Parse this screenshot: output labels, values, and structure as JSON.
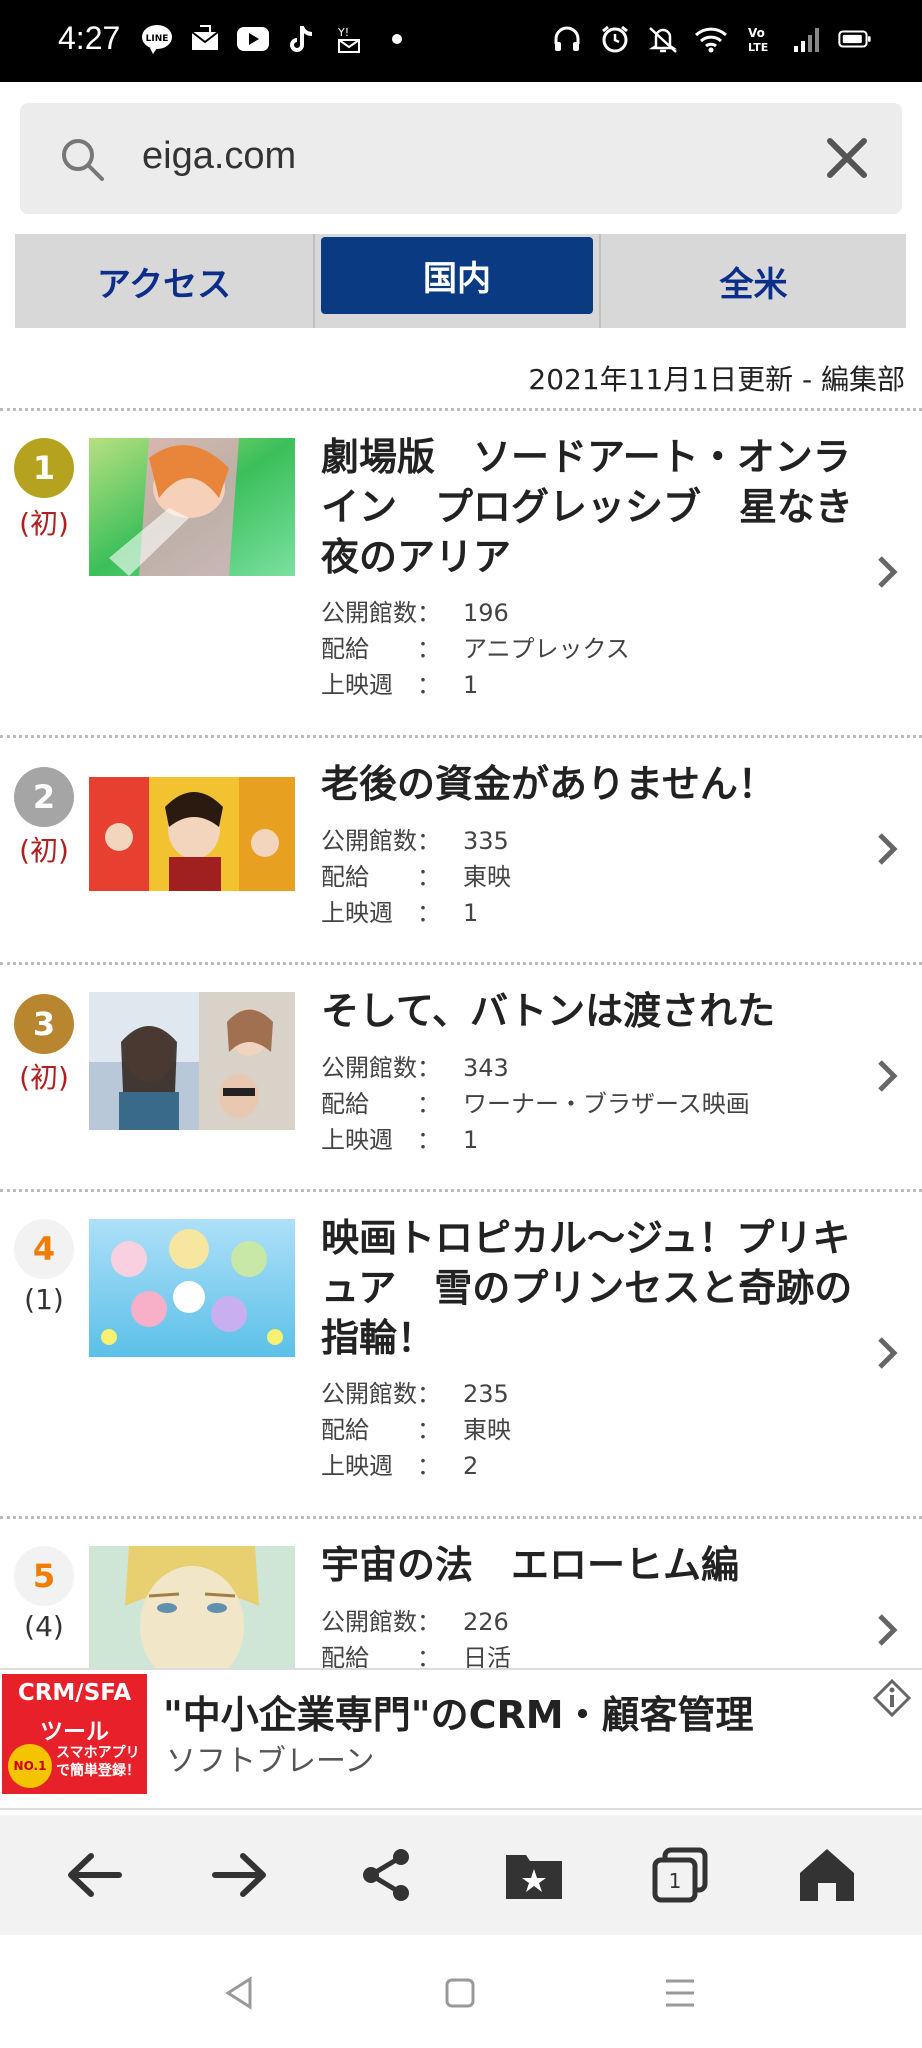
{
  "status_bar": {
    "time": "4:27",
    "left_icons": [
      "line-icon",
      "mail-icon",
      "youtube-icon",
      "tiktok-icon",
      "yahoo-mail-icon",
      "dot-icon"
    ],
    "right_icons": [
      "headphones-icon",
      "alarm-icon",
      "vibrate-off-icon",
      "wifi-icon",
      "volte-icon",
      "signal-icon",
      "battery-icon"
    ],
    "volte_label": "Vo LTE"
  },
  "url_bar": {
    "url": "eiga.com"
  },
  "tabs": [
    {
      "label": "アクセス",
      "active": false
    },
    {
      "label": "国内",
      "active": true
    },
    {
      "label": "全米",
      "active": false
    }
  ],
  "updated_text": "2021年11月1日更新 - 編集部",
  "meta_labels": {
    "theaters": "公開館数：",
    "distributor": "配給　　：",
    "weeks": "上映週　："
  },
  "rankings": [
    {
      "rank": "1",
      "previous": "(初)",
      "badge_color": "#b5a31f",
      "title": "劇場版　ソードアート・オンライン　プログレッシブ　星なき夜のアリア",
      "theaters": "196",
      "distributor": "アニプレックス",
      "weeks": "1"
    },
    {
      "rank": "2",
      "previous": "(初)",
      "badge_color": "#a5a5a5",
      "title": "老後の資金がありません！",
      "theaters": "335",
      "distributor": "東映",
      "weeks": "1"
    },
    {
      "rank": "3",
      "previous": "(初)",
      "badge_color": "#b8862f",
      "title": "そして、バトンは渡された",
      "theaters": "343",
      "distributor": "ワーナー・ブラザース映画",
      "weeks": "1"
    },
    {
      "rank": "4",
      "previous": "(1)",
      "badge_color": "#f07d00",
      "title": "映画トロピカル〜ジュ！プリキュア　雪のプリンセスと奇跡の指輪！",
      "theaters": "235",
      "distributor": "東映",
      "weeks": "2"
    },
    {
      "rank": "5",
      "previous": "(4)",
      "badge_color": "#f07d00",
      "title": "宇宙の法　エローヒム編",
      "theaters": "226",
      "distributor": "日活",
      "weeks": ""
    }
  ],
  "ad": {
    "image_line1": "CRM/SFA",
    "image_line2": "ツール",
    "image_badge": "NO.1",
    "image_line3": "スマホアプリで簡単登録！",
    "title": "\"中小企業専門\"のCRM・顧客管理",
    "subtitle": "ソフトブレーン"
  },
  "toolbar": {
    "buttons": [
      "back-icon",
      "forward-icon",
      "share-icon",
      "bookmarks-icon",
      "tabs-icon",
      "home-icon"
    ],
    "tab_count": "1"
  },
  "colors": {
    "tab_active": "#0a3a82",
    "tab_text": "#0b2e8a",
    "previous_new": "#b02020"
  }
}
